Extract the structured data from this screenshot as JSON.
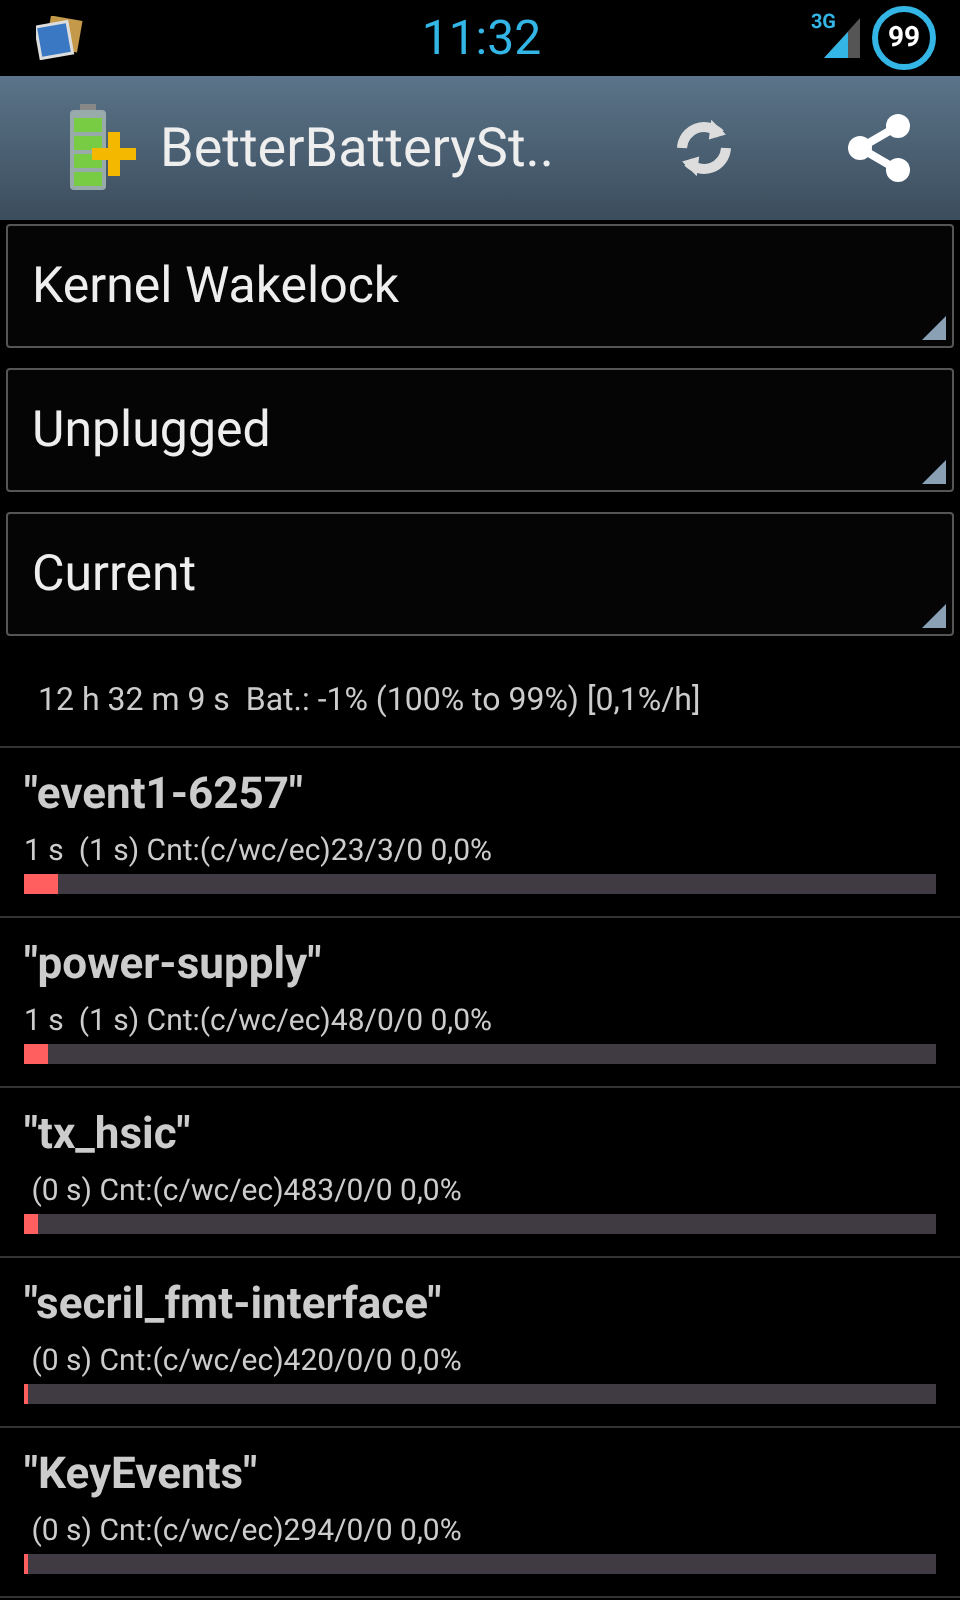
{
  "status_bar": {
    "time": "11:32",
    "network": "3G",
    "battery": "99"
  },
  "action_bar": {
    "title": "BetterBatterySt.."
  },
  "spinners": [
    {
      "value": "Kernel Wakelock"
    },
    {
      "value": "Unplugged"
    },
    {
      "value": "Current"
    }
  ],
  "summary": "12 h 32 m 9 s  Bat.: -1% (100% to 99%) [0,1%/h]",
  "wakelocks": [
    {
      "name": "\"event1-6257\"",
      "detail": "1 s  (1 s) Cnt:(c/wc/ec)23/3/0 0,0%",
      "level": 0.037
    },
    {
      "name": "\"power-supply\"",
      "detail": "1 s  (1 s) Cnt:(c/wc/ec)48/0/0 0,0%",
      "level": 0.026
    },
    {
      "name": "\"tx_hsic\"",
      "detail": " (0 s) Cnt:(c/wc/ec)483/0/0 0,0%",
      "level": 0.015
    },
    {
      "name": "\"secril_fmt-interface\"",
      "detail": " (0 s) Cnt:(c/wc/ec)420/0/0 0,0%",
      "level": 0.004
    },
    {
      "name": "\"KeyEvents\"",
      "detail": " (0 s) Cnt:(c/wc/ec)294/0/0 0,0%",
      "level": 0.004
    }
  ]
}
